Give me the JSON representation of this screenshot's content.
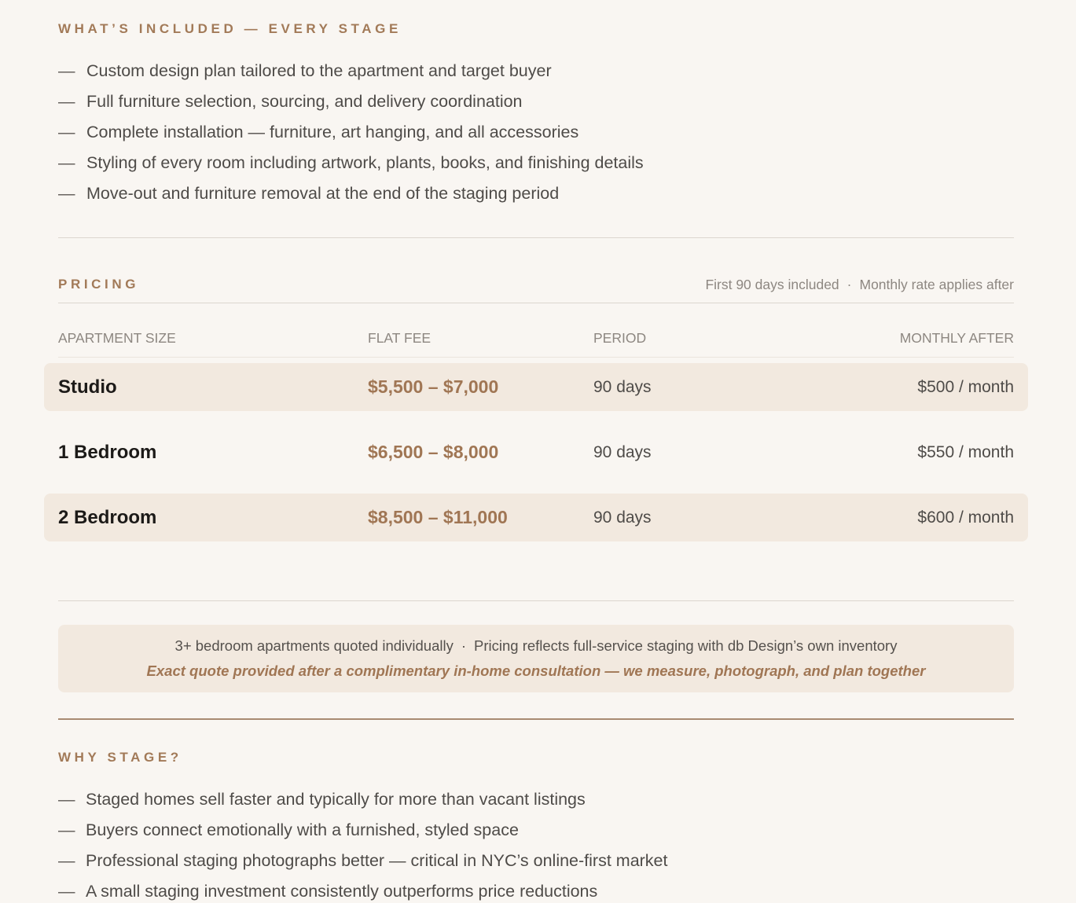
{
  "included": {
    "heading": "WHAT’S INCLUDED — EVERY STAGE",
    "bullet": "—",
    "items": [
      "Custom design plan tailored to the apartment and target buyer",
      "Full furniture selection, sourcing, and delivery coordination",
      "Complete installation — furniture, art hanging, and all accessories",
      "Styling of every room including artwork, plants, books, and finishing details",
      "Move-out and furniture removal at the end of the staging period"
    ]
  },
  "pricing": {
    "heading": "PRICING",
    "note_left": "First 90 days included",
    "note_sep": "·",
    "note_right": "Monthly rate applies after",
    "columns": [
      "APARTMENT SIZE",
      "FLAT FEE",
      "PERIOD",
      "MONTHLY AFTER"
    ],
    "rows": [
      {
        "size": "Studio",
        "fee": "$5,500 – $7,000",
        "period": "90 days",
        "monthly": "$500 / month"
      },
      {
        "size": "1 Bedroom",
        "fee": "$6,500 – $8,000",
        "period": "90 days",
        "monthly": "$550 / month"
      },
      {
        "size": "2 Bedroom",
        "fee": "$8,500 – $11,000",
        "period": "90 days",
        "monthly": "$600 / month"
      }
    ],
    "footnote_left": "3+ bedroom apartments quoted individually",
    "footnote_sep": "·",
    "footnote_right": "Pricing reflects full-service staging with db Design’s own inventory",
    "footnote_emphasis": "Exact quote provided after a complimentary in-home consultation — we measure, photograph, and plan together"
  },
  "why": {
    "heading": "WHY STAGE?",
    "bullet": "—",
    "items": [
      "Staged homes sell faster and typically for more than vacant listings",
      "Buyers connect emotionally with a furnished, styled space",
      "Professional staging photographs better — critical in NYC’s online-first market",
      "A small staging investment consistently outperforms price reductions"
    ]
  },
  "colors": {
    "accent": "#a07654",
    "background": "#f9f6f2",
    "row_shade": "#f2e9df"
  }
}
